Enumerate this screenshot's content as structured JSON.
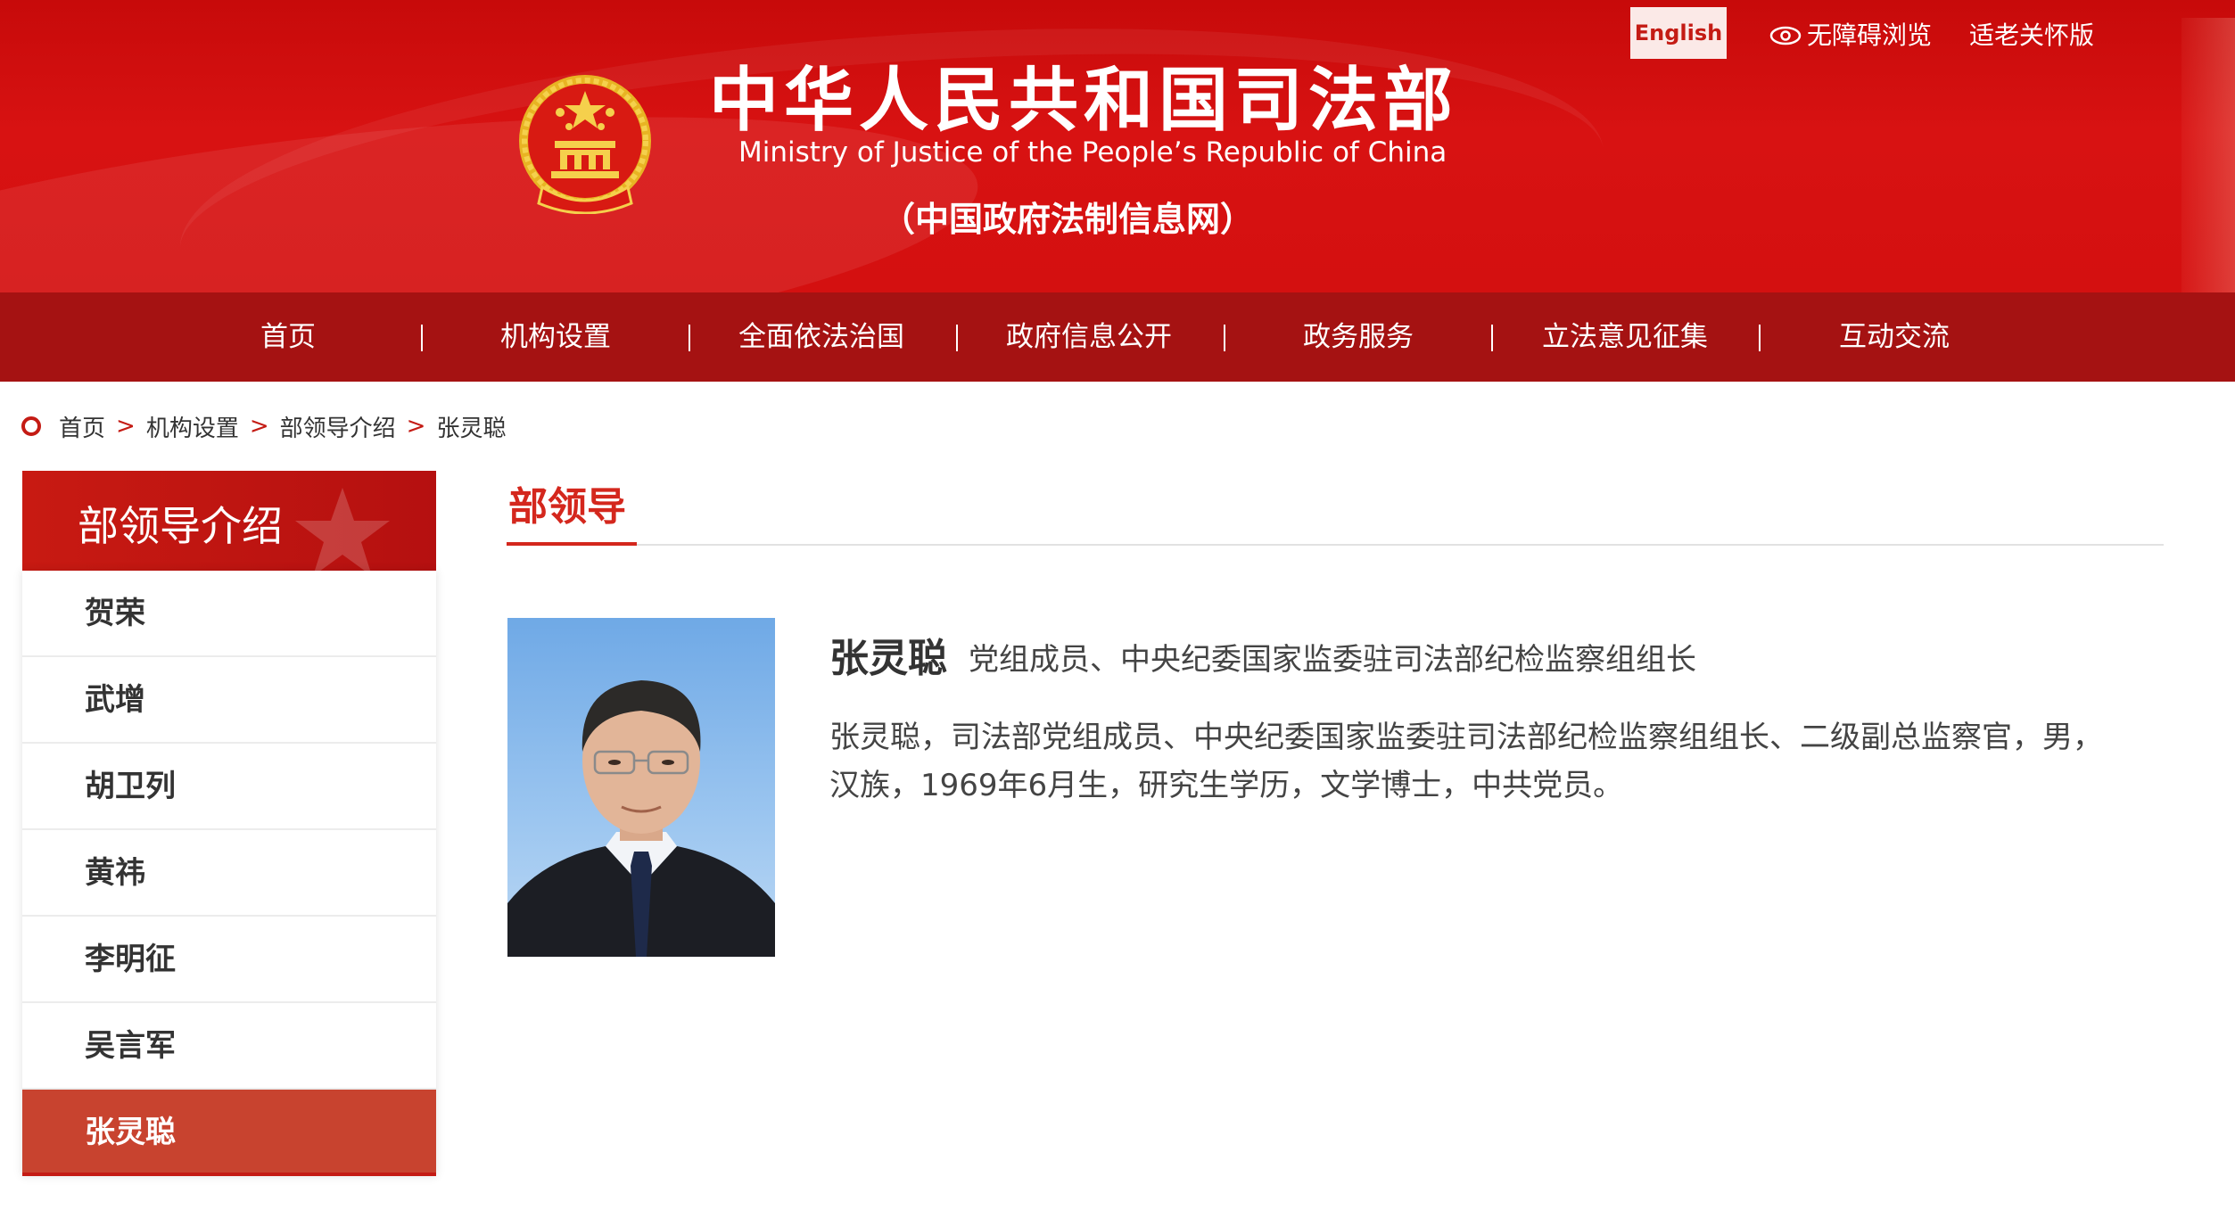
{
  "header": {
    "title_cn": "中华人民共和国司法部",
    "title_en": "Ministry of Justice of the People’s Republic of China",
    "subtitle": "（中国政府法制信息网）",
    "english_label": "English",
    "accessible_label": "无障碍浏览",
    "elder_label": "适老关怀版"
  },
  "nav": {
    "items": [
      "首页",
      "机构设置",
      "全面依法治国",
      "政府信息公开",
      "政务服务",
      "立法意见征集",
      "互动交流"
    ]
  },
  "breadcrumb": {
    "items": [
      "首页",
      "机构设置",
      "部领导介绍",
      "张灵聪"
    ],
    "separator": ">"
  },
  "sidebar": {
    "title": "部领导介绍",
    "items": [
      "贺荣",
      "武增",
      "胡卫列",
      "黄祎",
      "李明征",
      "吴言军",
      "张灵聪"
    ],
    "active_index": 6
  },
  "main": {
    "section_title": "部领导",
    "leader": {
      "name": "张灵聪",
      "title": "党组成员、中央纪委国家监委驻司法部纪检监察组组长",
      "bio": "张灵聪，司法部党组成员、中央纪委国家监委驻司法部纪检监察组组长、二级副总监察官，男，汉族，1969年6月生，研究生学历，文学博士，中共党员。"
    }
  },
  "colors": {
    "brand_red": "#d41010",
    "nav_red": "#a51212",
    "accent_red": "#d4271d",
    "active_item": "#c8432f"
  },
  "icons": {
    "emblem": "national-emblem-icon",
    "eye": "eye-icon",
    "breadcrumb_marker": "location-ring-icon"
  }
}
